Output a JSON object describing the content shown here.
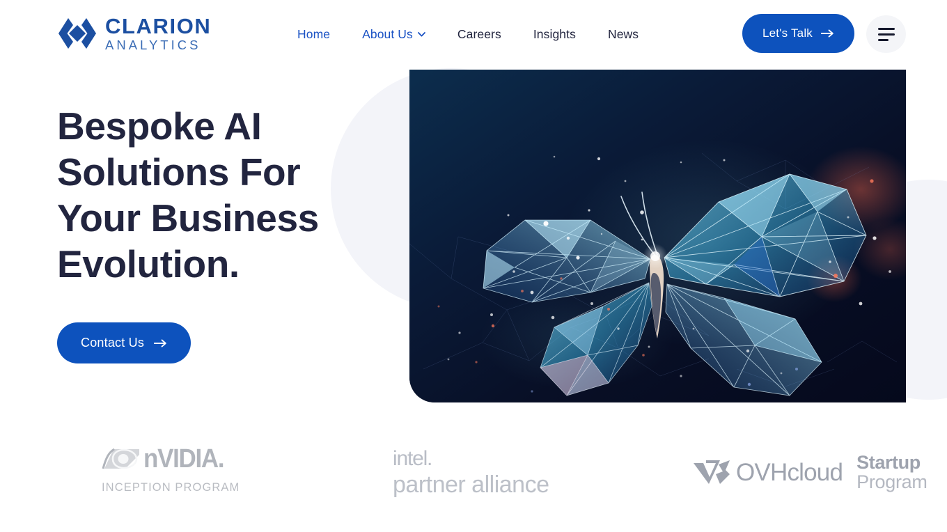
{
  "brand": {
    "logo_icon": "clarion-diamond-logo-icon",
    "name_top": "CLARION",
    "name_bottom": "ANALYTICS",
    "primary_color": "#0d52bd",
    "logo_color": "#1c4fa1",
    "heading_color": "#22253f"
  },
  "header": {
    "nav": [
      {
        "label": "Home",
        "active": true,
        "has_dropdown": false
      },
      {
        "label": "About Us",
        "active": true,
        "has_dropdown": true,
        "dropdown_icon": "chevron-down-icon"
      },
      {
        "label": "Careers",
        "active": false,
        "has_dropdown": false
      },
      {
        "label": "Insights",
        "active": false,
        "has_dropdown": false
      },
      {
        "label": "News",
        "active": false,
        "has_dropdown": false
      }
    ],
    "cta_label": "Let's Talk",
    "cta_icon": "arrow-right-icon",
    "menu_icon": "hamburger-menu-icon"
  },
  "hero": {
    "title": "Bespoke AI Solutions For Your Business Evolution.",
    "button_label": "Contact Us",
    "button_icon": "arrow-right-icon",
    "image_alt": "low-poly-wireframe-butterfly-illustration",
    "image_bg_color": "#0b1430",
    "decoration_circle_color": "#f3f4f9"
  },
  "partners": [
    {
      "id": "nvidia",
      "icon": "nvidia-eye-logo-icon",
      "name": "nVIDIA.",
      "sub": "INCEPTION PROGRAM"
    },
    {
      "id": "intel",
      "icon": "intel-logo-icon",
      "name": "intel.",
      "sub": "partner alliance"
    },
    {
      "id": "ovhcloud",
      "icon": "ovhcloud-logo-icon",
      "name": "OVHcloud",
      "sub_bold": "Startup",
      "sub_light": "Program"
    }
  ]
}
